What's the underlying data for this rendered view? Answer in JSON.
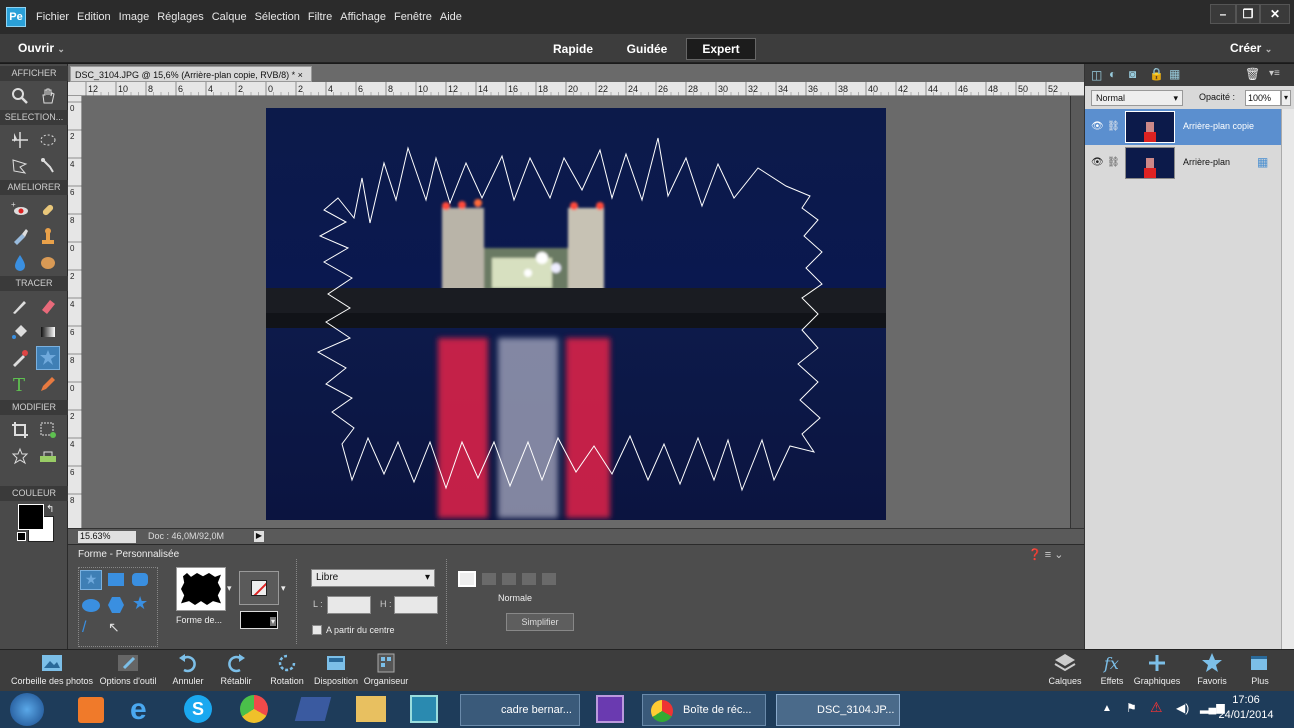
{
  "menu": {
    "items": [
      "Fichier",
      "Edition",
      "Image",
      "Réglages",
      "Calque",
      "Sélection",
      "Filtre",
      "Affichage",
      "Fenêtre",
      "Aide"
    ]
  },
  "modebar": {
    "open": "Ouvrir",
    "tabs": [
      "Rapide",
      "Guidée",
      "Expert"
    ],
    "active": "Expert",
    "create": "Créer"
  },
  "tools": {
    "sections": [
      "AFFICHER",
      "SELECTION...",
      "AMELIORER",
      "TRACER",
      "MODIFIER",
      "COULEUR"
    ]
  },
  "document": {
    "tab": "DSC_3104.JPG @ 15,6% (Arrière-plan copie, RVB/8) * ×",
    "zoom": "15.63%",
    "doc_size": "Doc : 46,0M/92,0M",
    "ruler_top": [
      "12",
      "10",
      "8",
      "6",
      "4",
      "2",
      "0",
      "2",
      "4",
      "6",
      "8",
      "10",
      "12",
      "14",
      "16",
      "18",
      "20",
      "22",
      "24",
      "26",
      "28",
      "30",
      "32",
      "34",
      "36",
      "38",
      "40",
      "42",
      "44",
      "46",
      "48",
      "50",
      "52"
    ],
    "ruler_left": [
      "0",
      "2",
      "4",
      "6",
      "8",
      "0",
      "2",
      "4",
      "6",
      "8",
      "0",
      "2",
      "4",
      "6",
      "8"
    ]
  },
  "options": {
    "title": "Forme - Personnalisée",
    "shape_label": "Forme de...",
    "dropdown": "Libre",
    "l_label": "L :",
    "h_label": "H :",
    "from_center": "A partir du centre",
    "mode": "Normale",
    "simplify": "Simplifier"
  },
  "layers": {
    "blend_mode": "Normal",
    "opacity_label": "Opacité :",
    "opacity": "100%",
    "items": [
      {
        "name": "Arrière-plan copie",
        "selected": true
      },
      {
        "name": "Arrière-plan",
        "selected": false
      }
    ]
  },
  "bottombar": {
    "left": [
      "Corbeille des photos",
      "Options d'outil",
      "Annuler",
      "Rétablir",
      "Rotation",
      "Disposition",
      "Organiseur"
    ],
    "right": [
      "Calques",
      "Effets",
      "Graphiques",
      "Favoris",
      "Plus"
    ]
  },
  "taskbar": {
    "items": [
      "cadre bernar...",
      "Boîte de réc...",
      "DSC_3104.JP..."
    ],
    "time": "17:06",
    "date": "24/01/2014"
  },
  "colors": {
    "accent": "#3f7fb5",
    "layer_selected": "#5b8fcf"
  }
}
